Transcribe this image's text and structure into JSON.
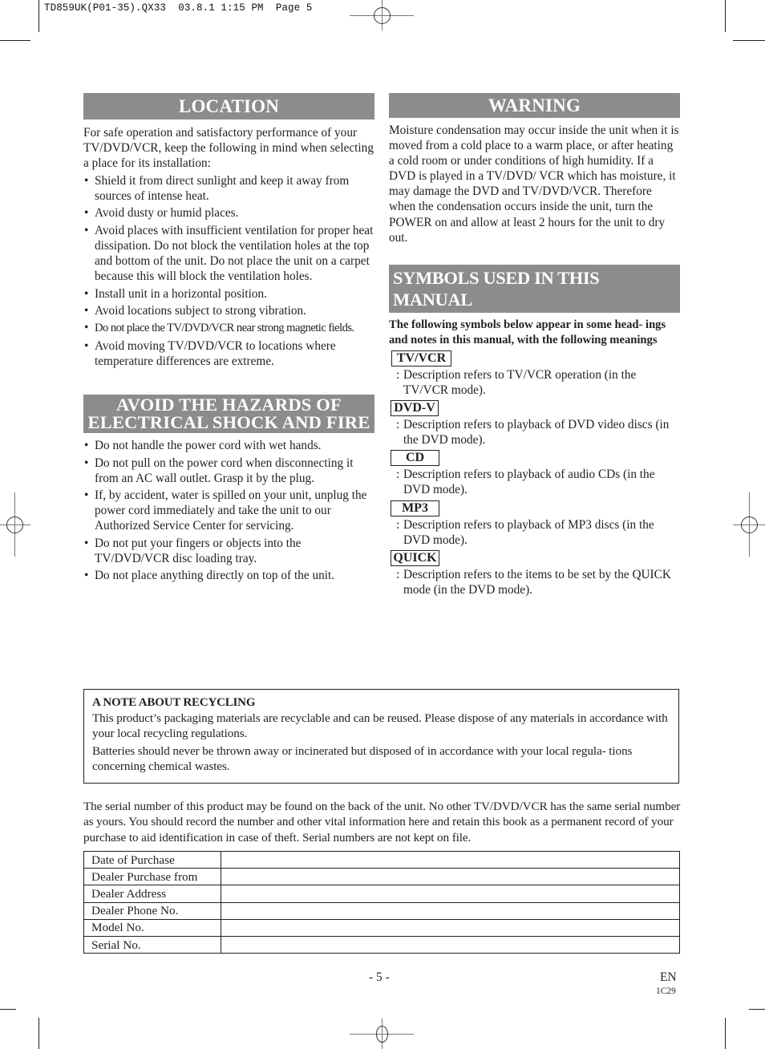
{
  "slug": {
    "text": "TD859UK(P01-35).QX33  03.8.1 1:15 PM  Page 5"
  },
  "location": {
    "heading": "LOCATION",
    "intro": "For safe operation and satisfactory performance of your TV/DVD/VCR, keep the following in mind when selecting a place for its installation:",
    "bullets": [
      "Shield it from direct sunlight and keep it away from sources of intense heat.",
      "Avoid dusty or humid places.",
      "Avoid places with insufficient ventilation for proper heat dissipation. Do not block the ventilation holes at the top and bottom of the unit. Do not place the unit on a carpet because this will block the ventilation holes.",
      "Install unit in a horizontal position.",
      "Avoid locations subject to strong vibration.",
      "Do not place the TV/DVD/VCR near strong magnetic fields.",
      "Avoid moving TV/DVD/VCR to locations where temperature differences are extreme."
    ],
    "bullet_glyph": "•"
  },
  "hazards": {
    "heading_line1": "AVOID THE HAZARDS OF",
    "heading_line2": "ELECTRICAL SHOCK AND FIRE",
    "bullets": [
      "Do not handle the power cord with wet hands.",
      "Do not pull on the power cord when disconnecting it from an AC wall outlet. Grasp it by the plug.",
      "If, by accident, water is spilled on your unit, unplug the power cord immediately and take the unit to our Authorized Service Center for servicing.",
      "Do not put your fingers or objects into the TV/DVD/VCR disc loading tray.",
      "Do not place anything directly on top of the unit."
    ]
  },
  "warning": {
    "heading": "WARNING",
    "body": "Moisture condensation may occur inside the unit when it is moved from a cold place to a warm place, or after heating a cold room or under conditions of high humidity. If a DVD is played in a TV/DVD/ VCR which has moisture, it may damage the DVD and TV/DVD/VCR. Therefore when the condensation occurs inside the unit, turn the POWER on and allow at least 2 hours for the unit to dry out."
  },
  "symbols": {
    "heading": "SYMBOLS USED IN THIS MANUAL",
    "intro": "The following symbols below appear in some head- ings and notes in this manual, with the following meanings",
    "colon": ":",
    "items": [
      {
        "label": "TV/VCR",
        "description": "Description refers to TV/VCR operation (in the TV/VCR mode)."
      },
      {
        "label": "DVD-V",
        "description": "Description refers to playback of DVD video discs (in the DVD mode)."
      },
      {
        "label": "CD",
        "description": "Description refers to playback of audio CDs (in the DVD mode)."
      },
      {
        "label": "MP3",
        "description": "Description refers to playback of  MP3 discs (in the DVD mode)."
      },
      {
        "label": "QUICK",
        "description": "Description refers to the items to be set by the QUICK mode (in the DVD mode)."
      }
    ]
  },
  "recycling": {
    "title": "A NOTE ABOUT RECYCLING",
    "paragraphs": [
      "This product’s packaging materials are recyclable and can be reused. Please dispose of any materials in accordance with your local recycling regulations.",
      "Batteries should never be thrown away or incinerated but disposed of in accordance with your local regula- tions concerning chemical wastes."
    ]
  },
  "serial": {
    "text": "The serial number of this product may be found on the back of the unit. No other TV/DVD/VCR has the same serial number as yours. You should record the number and other vital information here and retain this book as a permanent record of your purchase to aid identification in case of theft. Serial numbers are not kept on file.",
    "rows": [
      {
        "label": "Date of Purchase",
        "value": ""
      },
      {
        "label": "Dealer Purchase from",
        "value": ""
      },
      {
        "label": "Dealer Address",
        "value": ""
      },
      {
        "label": "Dealer Phone No.",
        "value": ""
      },
      {
        "label": "Model No.",
        "value": ""
      },
      {
        "label": "Serial No.",
        "value": ""
      }
    ]
  },
  "footer": {
    "page_number": "- 5 -",
    "language": "EN",
    "code": "1C29"
  },
  "colors": {
    "heading_band": "#8d8b8c",
    "heading_text": "#ffffff",
    "body_text": "#231f20"
  }
}
